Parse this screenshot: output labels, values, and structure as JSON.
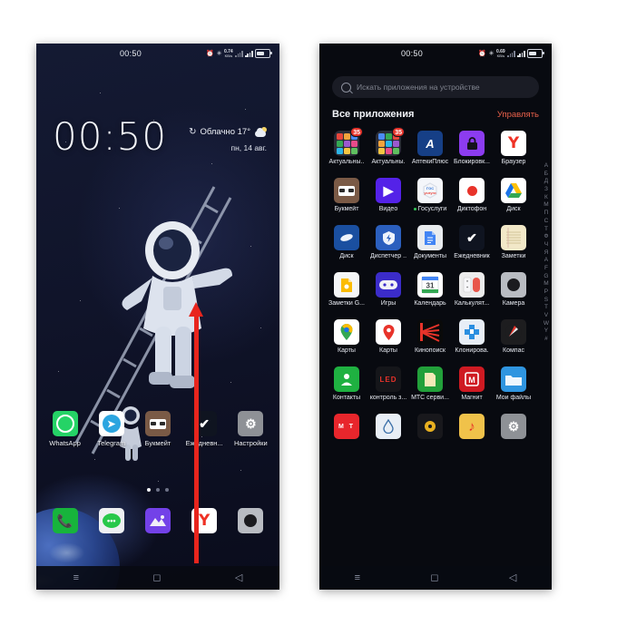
{
  "left_phone": {
    "status_bar": {
      "clock": "00:50",
      "alarm_icon": "alarm-icon",
      "bluetooth_icon": "bluetooth-icon",
      "data_speed_value": "0.74",
      "data_speed_unit": "KB/s",
      "signal_icon": "signal-bars-icon",
      "battery_icon": "battery-icon"
    },
    "lock": {
      "clock": "00:50",
      "refresh_icon": "refresh-icon",
      "weather": "Облачно 17°",
      "weather_icon": "cloudy-sun-icon",
      "date": "пн, 14 авг."
    },
    "page_dots": {
      "count": 3,
      "active_index": 0
    },
    "apps_row": [
      {
        "label": "WhatsApp",
        "icon": "whatsapp-icon"
      },
      {
        "label": "Telegram",
        "icon": "telegram-icon"
      },
      {
        "label": "Букмейт",
        "icon": "bookmate-icon"
      },
      {
        "label": "Ежедневн...",
        "icon": "daily-checklist-icon"
      },
      {
        "label": "Настройки",
        "icon": "settings-gear-icon"
      }
    ],
    "dock": [
      {
        "label": "",
        "icon": "phone-icon"
      },
      {
        "label": "",
        "icon": "messages-icon"
      },
      {
        "label": "",
        "icon": "gallery-icon"
      },
      {
        "label": "",
        "icon": "yandex-browser-icon"
      },
      {
        "label": "",
        "icon": "camera-icon"
      }
    ],
    "navbar": [
      {
        "icon": "recents-icon",
        "glyph": "≡"
      },
      {
        "icon": "home-icon",
        "glyph": "◻"
      },
      {
        "icon": "back-icon",
        "glyph": "◁"
      }
    ],
    "annotation": {
      "arrow": "swipe-up-arrow",
      "color": "#e8251d",
      "direction": "up"
    }
  },
  "right_phone": {
    "status_bar": {
      "clock": "00:50",
      "data_speed_value": "0.69",
      "data_speed_unit": "KB/s"
    },
    "search": {
      "placeholder": "Искать приложения на устройстве",
      "icon": "search-icon",
      "value": ""
    },
    "header": {
      "title": "Все приложения",
      "manage_label": "Управлять",
      "manage_color": "#e8604a"
    },
    "alphabet_index": [
      "А",
      "Б",
      "Д",
      "З",
      "К",
      "М",
      "П",
      "С",
      "Т",
      "Ф",
      "Ч",
      "Я",
      "A",
      "F",
      "G",
      "M",
      "P",
      "S",
      "T",
      "V",
      "W",
      "Y",
      "#"
    ],
    "app_rows": [
      [
        {
          "label": "Актуальны..",
          "icon": "folder-icon",
          "badge": "35"
        },
        {
          "label": "Актуальны.",
          "icon": "folder-icon",
          "badge": "35"
        },
        {
          "label": "АптекиПлюс",
          "icon": "apteki-plus-icon"
        },
        {
          "label": "Блокировк...",
          "icon": "app-lock-icon"
        },
        {
          "label": "Браузер",
          "icon": "yandex-browser-icon"
        }
      ],
      [
        {
          "label": "Букмейт",
          "icon": "bookmate-icon"
        },
        {
          "label": "Видео",
          "icon": "video-play-icon"
        },
        {
          "label": "Госуслуги",
          "icon": "gosuslugi-icon",
          "dot": true
        },
        {
          "label": "Диктофон",
          "icon": "voice-recorder-icon"
        },
        {
          "label": "Диск",
          "icon": "google-drive-icon"
        }
      ],
      [
        {
          "label": "Диск",
          "icon": "yandex-disk-icon"
        },
        {
          "label": "Диспетчер ..",
          "icon": "security-manager-icon"
        },
        {
          "label": "Документы",
          "icon": "google-docs-icon"
        },
        {
          "label": "Ежедневник",
          "icon": "daily-checklist-icon"
        },
        {
          "label": "Заметки",
          "icon": "notes-icon"
        }
      ],
      [
        {
          "label": "Заметки G...",
          "icon": "google-keep-icon"
        },
        {
          "label": "Игры",
          "icon": "games-gamepad-icon"
        },
        {
          "label": "Календарь",
          "icon": "google-calendar-icon"
        },
        {
          "label": "Калькулят...",
          "icon": "calculator-icon"
        },
        {
          "label": "Камера",
          "icon": "camera-icon"
        }
      ],
      [
        {
          "label": "Карты",
          "icon": "google-maps-icon"
        },
        {
          "label": "Карты",
          "icon": "yandex-maps-icon"
        },
        {
          "label": "Кинопоиск",
          "icon": "kinopoisk-icon"
        },
        {
          "label": "Клонирова.",
          "icon": "clone-apps-icon"
        },
        {
          "label": "Компас",
          "icon": "compass-icon"
        }
      ],
      [
        {
          "label": "Контакты",
          "icon": "contacts-icon"
        },
        {
          "label": "контроль з...",
          "icon": "led-control-icon"
        },
        {
          "label": "МТС серви...",
          "icon": "mts-services-icon"
        },
        {
          "label": "Магнит",
          "icon": "magnit-icon"
        },
        {
          "label": "Мои файлы",
          "icon": "my-files-icon"
        }
      ],
      [
        {
          "label": "",
          "icon": "mt-icon"
        },
        {
          "label": "",
          "icon": "water-drop-icon"
        },
        {
          "label": "",
          "icon": "music-disc-icon"
        },
        {
          "label": "",
          "icon": "music-note-icon"
        },
        {
          "label": "",
          "icon": "settings-gear-icon"
        }
      ]
    ],
    "navbar": [
      {
        "icon": "recents-icon",
        "glyph": "≡"
      },
      {
        "icon": "home-icon",
        "glyph": "◻"
      },
      {
        "icon": "back-icon",
        "glyph": "◁"
      }
    ]
  }
}
